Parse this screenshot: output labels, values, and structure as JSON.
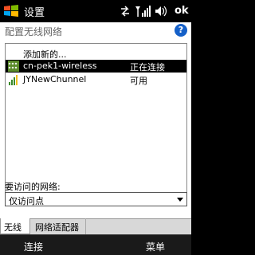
{
  "titlebar": {
    "title": "设置",
    "ok_label": "ok"
  },
  "header": {
    "text": "配置无线网络"
  },
  "help": {
    "glyph": "?"
  },
  "network_list": {
    "add_new": "添加新的...",
    "networks": [
      {
        "name": "cn-pek1-wireless",
        "status": "正在连接",
        "selected": true
      },
      {
        "name": "JYNewChunnel",
        "status": "可用",
        "selected": false
      }
    ]
  },
  "access": {
    "label": "要访问的网络:",
    "selected_value": "仅访问点"
  },
  "tabs": [
    {
      "label": "无线",
      "active": true
    },
    {
      "label": "网络适配器",
      "active": false
    }
  ],
  "softkeys": {
    "left": "连接",
    "right": "菜单"
  },
  "colors": {
    "accent": "#1560c8",
    "selection": "#000000"
  }
}
